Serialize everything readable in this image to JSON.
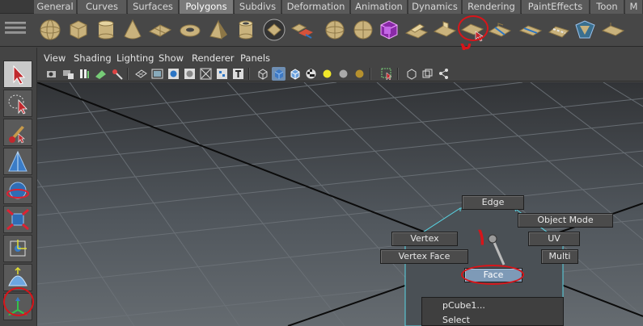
{
  "shelf": {
    "tabs": [
      "General",
      "Curves",
      "Surfaces",
      "Polygons",
      "Subdivs",
      "Deformation",
      "Animation",
      "Dynamics",
      "Rendering",
      "PaintEffects",
      "Toon",
      "M"
    ],
    "active_tab": "Polygons",
    "icons": [
      "sphere-icon",
      "cube-icon",
      "cylinder-icon",
      "cone-icon",
      "plane-icon",
      "torus-icon",
      "pyramid-icon",
      "pipe-icon",
      "platonic-icon",
      "combine-icon",
      "separate-icon",
      "smooth-icon",
      "subdiv-proxy-icon",
      "extrude-icon",
      "bridge-icon",
      "append-icon",
      "split-polygon-icon",
      "insert-edge-loop-icon",
      "offset-edge-loop-icon",
      "bevel-icon",
      "merge-icon",
      "wedge-icon",
      "slide-edge-icon",
      "flip-edge-icon"
    ]
  },
  "annotations": {
    "num_shelf": "۲",
    "num_viewport": "۱",
    "num_toolbox": "۳",
    "color": "#d8151a"
  },
  "tools": [
    "select-tool-icon",
    "lasso-tool-icon",
    "paint-select-tool-icon",
    "move-tool-icon",
    "rotate-tool-icon",
    "scale-tool-icon",
    "universal-manipulator-icon",
    "soft-mod-icon",
    "show-manipulator-icon"
  ],
  "panel_menu": [
    "View",
    "Shading",
    "Lighting",
    "Show",
    "Renderer",
    "Panels"
  ],
  "marking_menu": {
    "edge": "Edge",
    "object_mode": "Object Mode",
    "vertex": "Vertex",
    "uv": "UV",
    "vertex_face": "Vertex Face",
    "multi": "Multi",
    "face": "Face"
  },
  "context_menu": {
    "items": [
      "pCube1...",
      "Select"
    ]
  },
  "colors": {
    "active_item": "#7e9ab7",
    "selection_wire": "#5ad8e6"
  }
}
